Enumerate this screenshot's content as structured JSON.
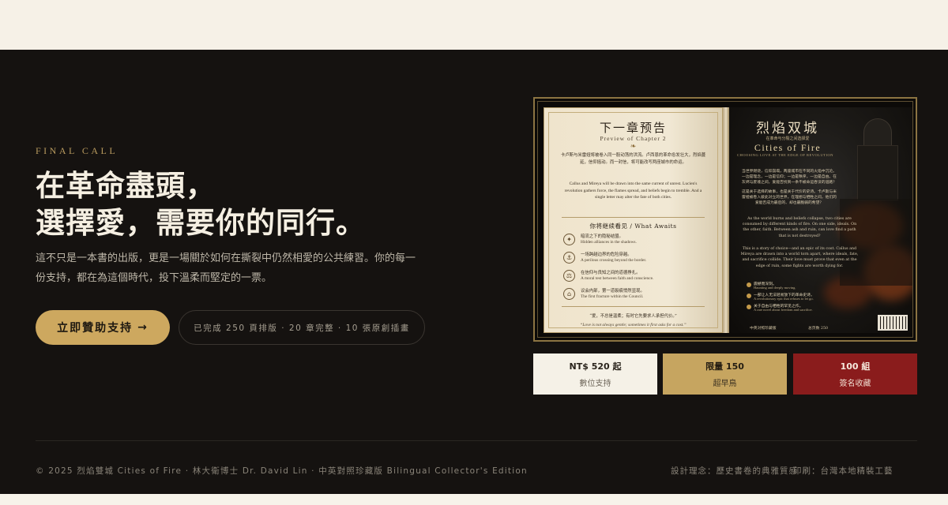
{
  "hero": {
    "eyebrow": "FINAL CALL",
    "headline_line1": "在革命盡頭，",
    "headline_line2": "選擇愛，需要你的同行。",
    "description": "這不只是一本書的出版，更是一場關於如何在撕裂中仍然相愛的公共練習。你的每一份支持，都在為這個時代，投下溫柔而堅定的一票。",
    "cta_label": "立即贊助支持",
    "cta_icon": "arrow-right-icon",
    "progress_pill": "已完成 250 頁排版 · 20 章完整 · 10 張原創插畫"
  },
  "book": {
    "left_page": {
      "title": "下一章预告",
      "subtitle": "Preview of Chapter 2",
      "cn_text": "卡卢斯与米雷娅将被卷入同一股动荡的洪流。卢西恩的革命愈发壮大，烈焰蔓延，信仰摇动。而一封信，将可能改写两座城市的命运。",
      "en_text": "Callus and Mireya will be drawn into the same current of unrest. Lucien's revolution gathers force, the flames spread, and beliefs begin to tremble. And a single letter may alter the fate of both cities.",
      "await_title": "你将继续看见 / What Awaits",
      "items": [
        {
          "icon": "compass-icon",
          "cn": "暗流之下的隐秘结盟。",
          "en": "Hidden alliances in the shadows."
        },
        {
          "icon": "ship-icon",
          "cn": "一场跨越边界的危险穿越。",
          "en": "A perilous crossing beyond the border."
        },
        {
          "icon": "scales-icon",
          "cn": "在信仰与良知之间的道德挣扎。",
          "en": "A moral test between faith and conscience."
        },
        {
          "icon": "temple-icon",
          "cn": "议会内部，第一道裂痕悄然显现。",
          "en": "The first fracture within the Council."
        }
      ],
      "quote_cn": "“爱，不总是温柔；有时它先要求人承担代价。”",
      "quote_en": "“Love is not always gentle; sometimes it first asks for a cost.”"
    },
    "right_page": {
      "title": "烈焰双城",
      "tagline": "在革命与分裂之间选择爱",
      "en_title": "Cities of Fire",
      "en_subtitle": "CHOOSING LOVE AT THE EDGE OF REVOLUTION",
      "blurb_cn_1": "当世界燃烧，信仰崩塌，两座城市在不同的火焰中沉沦。一边是理念，一边是信仰；一边是秩序，一边是自由。在灰烬与废墟之间，爱能否找到一条不被命运吞没的道路？",
      "blurb_cn_2": "这是关于选择的故事，也是关于代价的史诗。卡卢斯与米雷娅被卷入彼此对立的世界，在理想与牺牲之间，他们的爱能否成为最后的、却也最脆弱的希望？",
      "blurb_en": "As the world burns and beliefs collapse, two cities are consumed by different kinds of fire. On one side, ideals. On the other, faith. Between ash and ruin, can love find a path that is not destroyed?",
      "blurb_en_2": "This is a story of choice—and an epic of its cost. Callus and Mireya are drawn into a world torn apart, where ideals, fate, and sacrifice collide. Their love must prove that even at the edge of ruin, some fights are worth dying for.",
      "list": [
        {
          "cn": "震撼而深刻。",
          "en": "Haunting and deeply moving."
        },
        {
          "cn": "一部让人无法轻易放下的革命史诗。",
          "en": "A revolutionary epic that refuses to let go."
        },
        {
          "cn": "关于自由与牺牲的罕见之作。",
          "en": "A rare novel about freedom and sacrifice."
        }
      ],
      "foot_left": "中英对照珍藏版",
      "foot_right": "总页数 250"
    }
  },
  "tiers": [
    {
      "big": "NT$ 520 起",
      "small": "數位支持"
    },
    {
      "big": "限量 150",
      "small": "超早鳥"
    },
    {
      "big": "100 組",
      "small": "簽名收藏"
    }
  ],
  "footer": {
    "copyright": "© 2025 烈焰雙城 Cities of Fire · 林大衛博士 Dr. David Lin · 中英對照珍藏版 Bilingual Collector's Edition",
    "design": "設計理念：歷史書卷的典雅質感",
    "print": "印刷：台灣本地精裝工藝"
  },
  "colors": {
    "background_dark": "#151210",
    "gold": "#cda85f",
    "crimson": "#8a1c1c",
    "cream": "#f5f1e7"
  }
}
